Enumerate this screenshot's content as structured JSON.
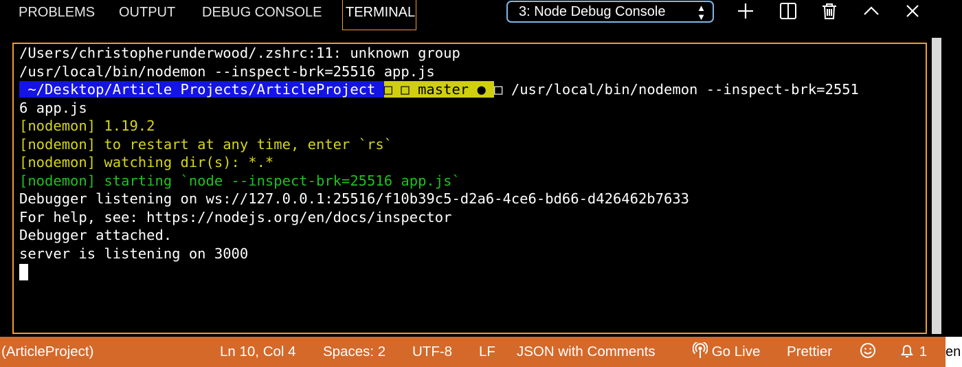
{
  "panel": {
    "tabs": [
      {
        "label": "PROBLEMS"
      },
      {
        "label": "OUTPUT"
      },
      {
        "label": "DEBUG CONSOLE"
      },
      {
        "label": "TERMINAL",
        "active": true
      }
    ],
    "terminal_select": {
      "selected": "3: Node Debug Console"
    },
    "icons": [
      "plus-icon",
      "split-icon",
      "trash-icon",
      "chevron-up-icon",
      "close-icon"
    ]
  },
  "terminal": {
    "lines": [
      "/Users/christopherunderwood/.zshrc:11: unknown group",
      "/usr/local/bin/nodemon --inspect-brk=25516 app.js",
      {
        "path": " ~/Desktop/Article Projects/ArticleProject ",
        "branch": "□ □ master ● ",
        "after": "□ /usr/local/bin/nodemon --inspect-brk=2551"
      },
      "6 app.js",
      "[nodemon] 1.19.2",
      "[nodemon] to restart at any time, enter `rs`",
      "[nodemon] watching dir(s): *.*",
      "[nodemon] starting `node --inspect-brk=25516 app.js`",
      "Debugger listening on ws://127.0.0.1:25516/f10b39c5-d2a6-4ce6-bd66-d426462b7633",
      "For help, see: https://nodejs.org/en/docs/inspector",
      "Debugger attached.",
      "server is listening on 3000"
    ],
    "colors": {
      "border": "#f39c33",
      "yellow": "#d6d61c",
      "green": "#1fc21f",
      "prompt_blue": "#1414e6",
      "prompt_yellow": "#cfcf10"
    }
  },
  "statusbar": {
    "project": "(ArticleProject)",
    "position": "Ln 10, Col 4",
    "spaces": "Spaces: 2",
    "encoding": "UTF-8",
    "eol": "LF",
    "language": "JSON with Comments",
    "golive": "Go Live",
    "prettier": "Prettier",
    "notifications": "1",
    "edge_text": "en",
    "background": "#d4692a"
  }
}
